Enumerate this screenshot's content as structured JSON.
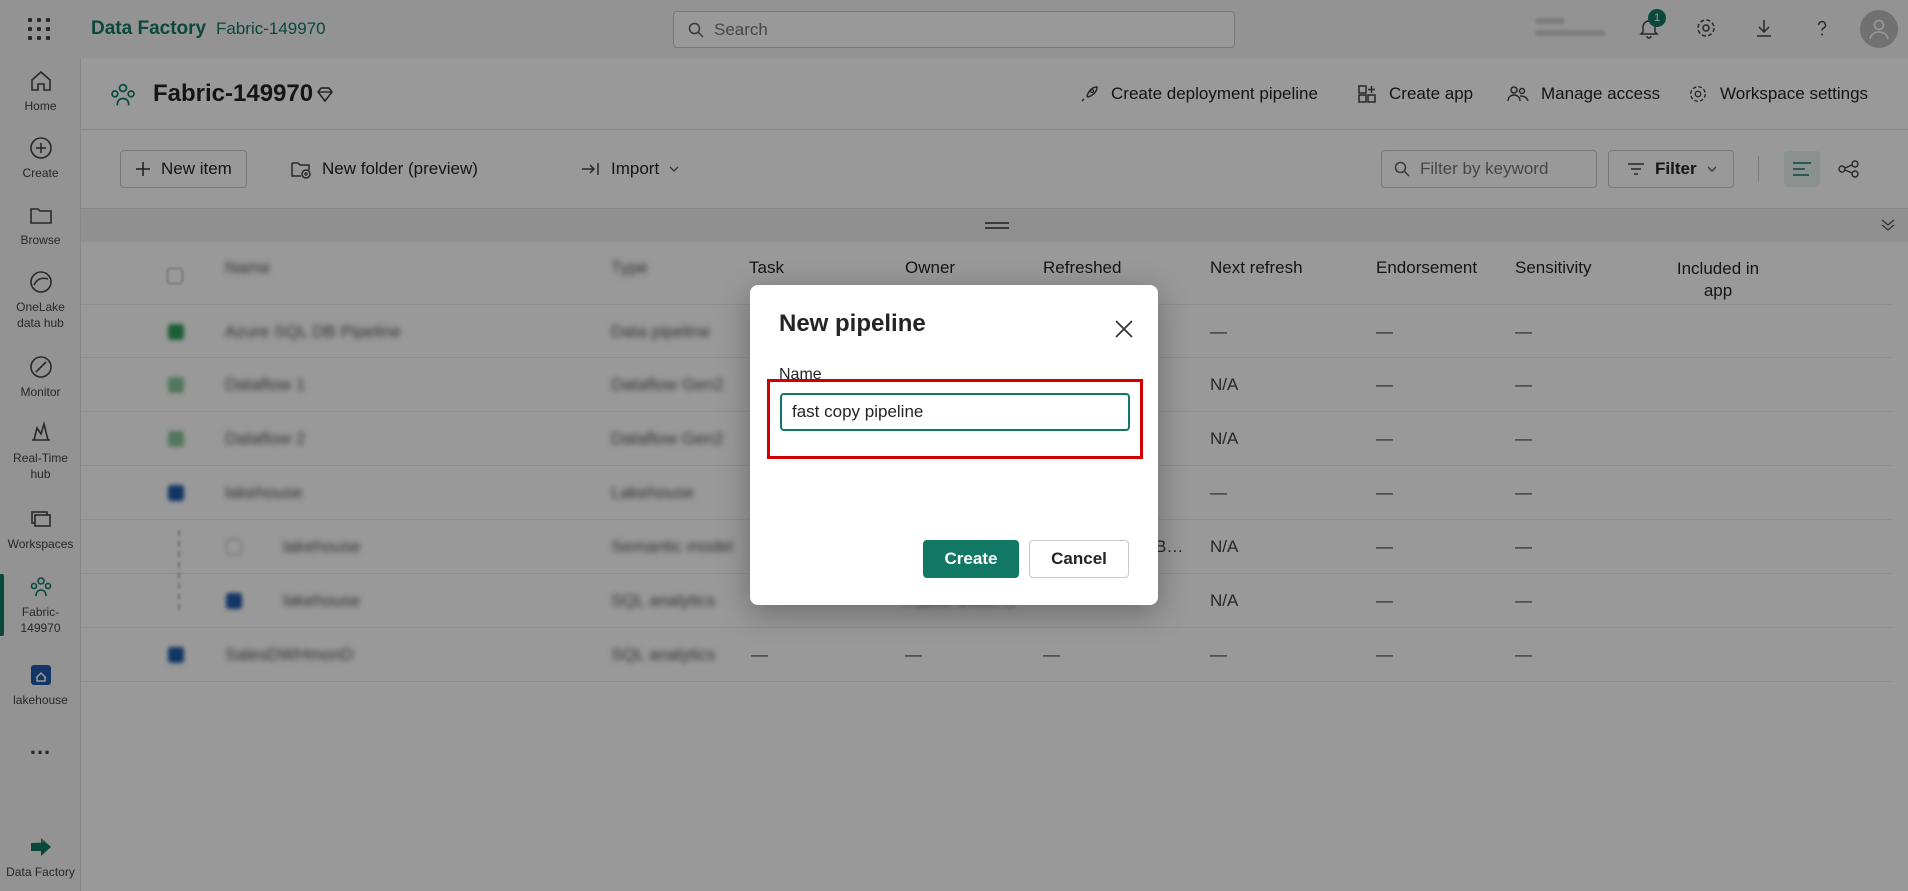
{
  "topbar": {
    "app_name": "Data Factory",
    "workspace_name": "Fabric-149970",
    "search_placeholder": "Search",
    "notification_count": "1"
  },
  "rail": {
    "items": [
      {
        "label": "Home"
      },
      {
        "label": "Create"
      },
      {
        "label": "Browse"
      },
      {
        "label": "OneLake data hub"
      },
      {
        "label": "Monitor"
      },
      {
        "label": "Real-Time hub"
      },
      {
        "label": "Workspaces"
      },
      {
        "label": "Fabric-149970"
      },
      {
        "label": "lakehouse"
      },
      {
        "label": "..."
      },
      {
        "label": "Data Factory"
      }
    ]
  },
  "workspace": {
    "title": "Fabric-149970",
    "actions": {
      "deployment": "Create deployment pipeline",
      "app": "Create app",
      "access": "Manage access",
      "settings": "Workspace settings"
    }
  },
  "toolbar": {
    "new_item": "New item",
    "new_folder": "New folder (preview)",
    "import": "Import",
    "filter_placeholder": "Filter by keyword",
    "filter": "Filter"
  },
  "table": {
    "columns": {
      "name": "Name",
      "type": "Type",
      "task": "Task",
      "owner": "Owner",
      "refreshed": "Refreshed",
      "next_refresh": "Next refresh",
      "endorsement": "Endorsement",
      "sensitivity": "Sensitivity",
      "included_line1": "Included in",
      "included_line2": "app"
    },
    "rows": [
      {
        "name": "Azure SQL DB Pipeline",
        "type": "Data pipeline",
        "next_refresh": "—",
        "endorsement": "—",
        "sensitivity": "—"
      },
      {
        "name": "Dataflow 1",
        "type": "Dataflow Gen2",
        "next_refresh": "N/A",
        "endorsement": "—",
        "sensitivity": "—"
      },
      {
        "name": "Dataflow 2",
        "type": "Dataflow Gen2",
        "next_refresh": "N/A",
        "endorsement": "—",
        "sensitivity": "—"
      },
      {
        "name": "lakehouse",
        "type": "Lakehouse",
        "next_refresh": "—",
        "endorsement": "—",
        "sensitivity": "—"
      },
      {
        "name": "lakehouse",
        "type": "Semantic model",
        "refreshed": "B…",
        "next_refresh": "N/A",
        "endorsement": "—",
        "sensitivity": "—"
      },
      {
        "name": "lakehouse",
        "type": "SQL analytics",
        "owner": "Fabric-149970",
        "next_refresh": "N/A",
        "endorsement": "—",
        "sensitivity": "—"
      },
      {
        "name": "SalesDWHmonD",
        "type": "SQL analytics",
        "task": "—",
        "owner": "—",
        "refreshed": "—",
        "next_refresh": "—",
        "endorsement": "—",
        "sensitivity": "—"
      }
    ]
  },
  "dialog": {
    "title": "New pipeline",
    "name_label": "Name",
    "name_value": "fast copy pipeline",
    "create": "Create",
    "cancel": "Cancel"
  },
  "colors": {
    "accent": "#117865",
    "highlight": "#d00000"
  }
}
